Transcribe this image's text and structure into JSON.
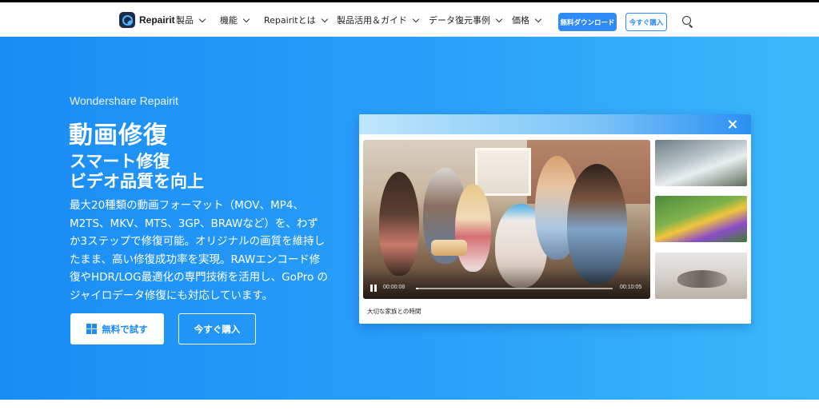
{
  "nav": {
    "brand": "Repairit",
    "items": [
      {
        "label": "製品"
      },
      {
        "label": "機能"
      },
      {
        "label": "Repairitとは"
      },
      {
        "label": "製品活用＆ガイド"
      },
      {
        "label": "データ復元事例"
      },
      {
        "label": "価格"
      }
    ],
    "download_label": "無料ダウンロード",
    "buy_label": "今すぐ購入"
  },
  "hero": {
    "eyebrow": "Wondershare Repairit",
    "title": "動画修復",
    "subtitle_line1": "スマート修復",
    "subtitle_line2": "ビデオ品質を向上",
    "description_lines": [
      "最大20種類の動画フォーマット（MOV、MP4、",
      "M2TS、MKV、MTS、3GP、BRAWなど）を、わず",
      "か3ステップで修復可能。オリジナルの画質を維持し",
      "たまま、高い修復成功率を実現。RAWエンコード修",
      "復やHDR/LOG最適化の専門技術を活用し、GoPro の",
      "ジャイロデータ修復にも対応しています。"
    ],
    "free_trial_label": "無料で試す",
    "buy_label": "今すぐ購入"
  },
  "demo": {
    "current_time": "00:00:08",
    "total_time": "00:10:05",
    "progress": 0.013,
    "caption": "大切な家族との時間"
  },
  "colors": {
    "accent": "#2f8af5",
    "hero_start": "#1a8cf6",
    "hero_end": "#3bb8fb"
  }
}
